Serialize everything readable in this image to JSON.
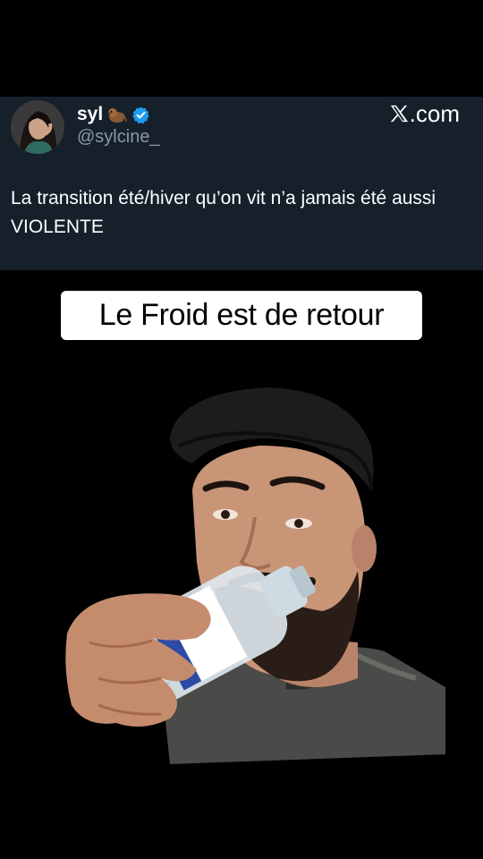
{
  "tweet": {
    "display_name": "syl",
    "handle": "@sylcine_",
    "brand_text": ".com",
    "text": "La transition été/hiver qu’on vit n’a jamais été aussi VIOLENTE",
    "bg_color": "#15202b",
    "verified_color": "#1d9bf0",
    "name_emoji": "otter-emoji"
  },
  "caption": {
    "text": "Le Froid est de retour"
  },
  "video": {
    "description_icon": "person-drinking-water-bottle"
  }
}
